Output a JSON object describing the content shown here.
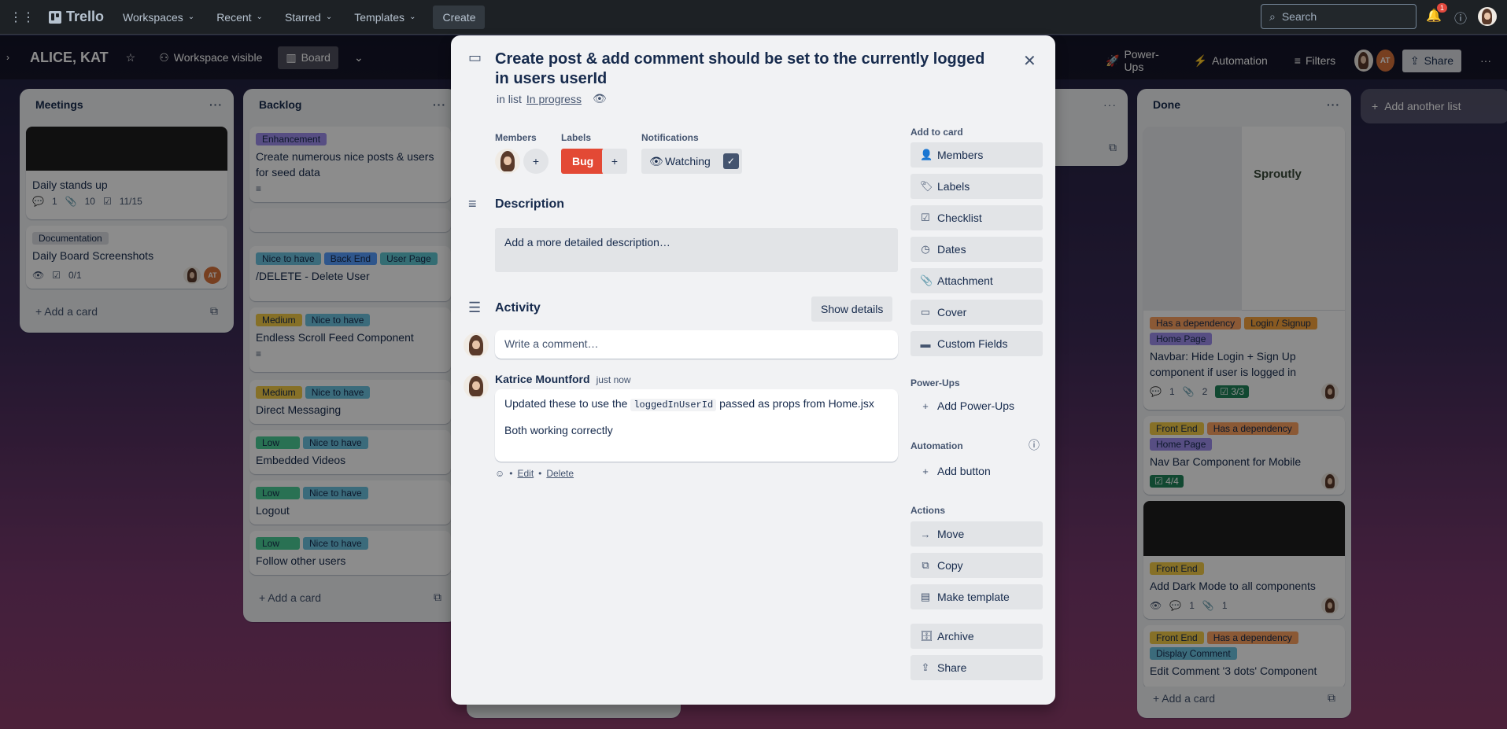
{
  "topbar": {
    "app_name": "Trello",
    "nav": [
      "Workspaces",
      "Recent",
      "Starred",
      "Templates"
    ],
    "create_label": "Create",
    "search_placeholder": "Search",
    "notif_count": "1"
  },
  "board": {
    "name": "ALICE, KAT",
    "visibility_label": "Workspace visible",
    "view_label": "Board",
    "powerups_label": "Power-Ups",
    "automation_label": "Automation",
    "filters_label": "Filters",
    "share_label": "Share",
    "member_initials": "AT"
  },
  "lists": {
    "meetings": {
      "title": "Meetings",
      "cards": [
        {
          "title": "Daily stands up",
          "comments": "1",
          "attachments": "10",
          "checklist": "11/15"
        },
        {
          "label": "Documentation",
          "title": "Daily Board Screenshots",
          "checklist": "0/1"
        }
      ],
      "add_card": "Add a card"
    },
    "backlog": {
      "title": "Backlog",
      "cards": [
        {
          "labels": [
            "Enhancement"
          ],
          "title": "Create numerous nice posts & users for seed data"
        },
        {
          "labels": [
            "Nice to have",
            "Back End",
            "User Page"
          ],
          "title": "/DELETE - Delete User"
        },
        {
          "labels": [
            "Medium",
            "Nice to have"
          ],
          "title": "Endless Scroll Feed Component"
        },
        {
          "labels": [
            "Medium",
            "Nice to have"
          ],
          "title": "Direct Messaging"
        },
        {
          "labels": [
            "Low",
            "Nice to have"
          ],
          "title": "Embedded Videos"
        },
        {
          "labels": [
            "Low",
            "Nice to have"
          ],
          "title": "Logout"
        },
        {
          "labels": [
            "Low",
            "Nice to have"
          ],
          "title": "Follow other users"
        }
      ],
      "add_card": "Add a card"
    },
    "done": {
      "title": "Done",
      "cards": [
        {
          "labels": [
            "Has a dependency",
            "Login / Signup",
            "Home Page"
          ],
          "title": "Navbar: Hide Login + Sign Up component if user is logged in",
          "comments": "1",
          "attachments": "2",
          "checklist": "3/3",
          "thumb_brand": "Sproutly"
        },
        {
          "labels": [
            "Front End",
            "Has a dependency",
            "Home Page"
          ],
          "title": "Nav Bar Component for Mobile",
          "checklist": "4/4"
        },
        {
          "labels": [
            "Front End"
          ],
          "title": "Add Dark Mode to all components",
          "comments": "1",
          "attachments": "1"
        },
        {
          "labels": [
            "Front End",
            "Has a dependency",
            "Display Comment"
          ],
          "title": "Edit Comment '3 dots' Component"
        }
      ],
      "add_card": "Add a card"
    },
    "add_another": "Add another list"
  },
  "modal": {
    "title": "Create post & add comment should be set to the currently logged in users userId",
    "in_list_prefix": "in list",
    "in_list_name": "In progress",
    "members_label": "Members",
    "labels_label": "Labels",
    "label_bug": "Bug",
    "notifications_label": "Notifications",
    "watching_label": "Watching",
    "description_heading": "Description",
    "description_placeholder": "Add a more detailed description…",
    "activity_heading": "Activity",
    "show_details": "Show details",
    "comment_placeholder": "Write a comment…",
    "comment": {
      "author": "Katrice Mountford",
      "time": "just now",
      "line1_pre": "Updated these to use the",
      "line1_code": "loggedInUserId",
      "line1_post": "passed as props from Home.jsx",
      "line2": "Both working correctly",
      "edit": "Edit",
      "delete": "Delete"
    },
    "sidebar": {
      "add_to_card": "Add to card",
      "add_items": [
        "Members",
        "Labels",
        "Checklist",
        "Dates",
        "Attachment",
        "Cover",
        "Custom Fields"
      ],
      "powerups_head": "Power-Ups",
      "add_powerups": "Add Power-Ups",
      "automation_head": "Automation",
      "add_button": "Add button",
      "actions_head": "Actions",
      "actions": [
        "Move",
        "Copy",
        "Make template",
        "Archive",
        "Share"
      ]
    }
  }
}
